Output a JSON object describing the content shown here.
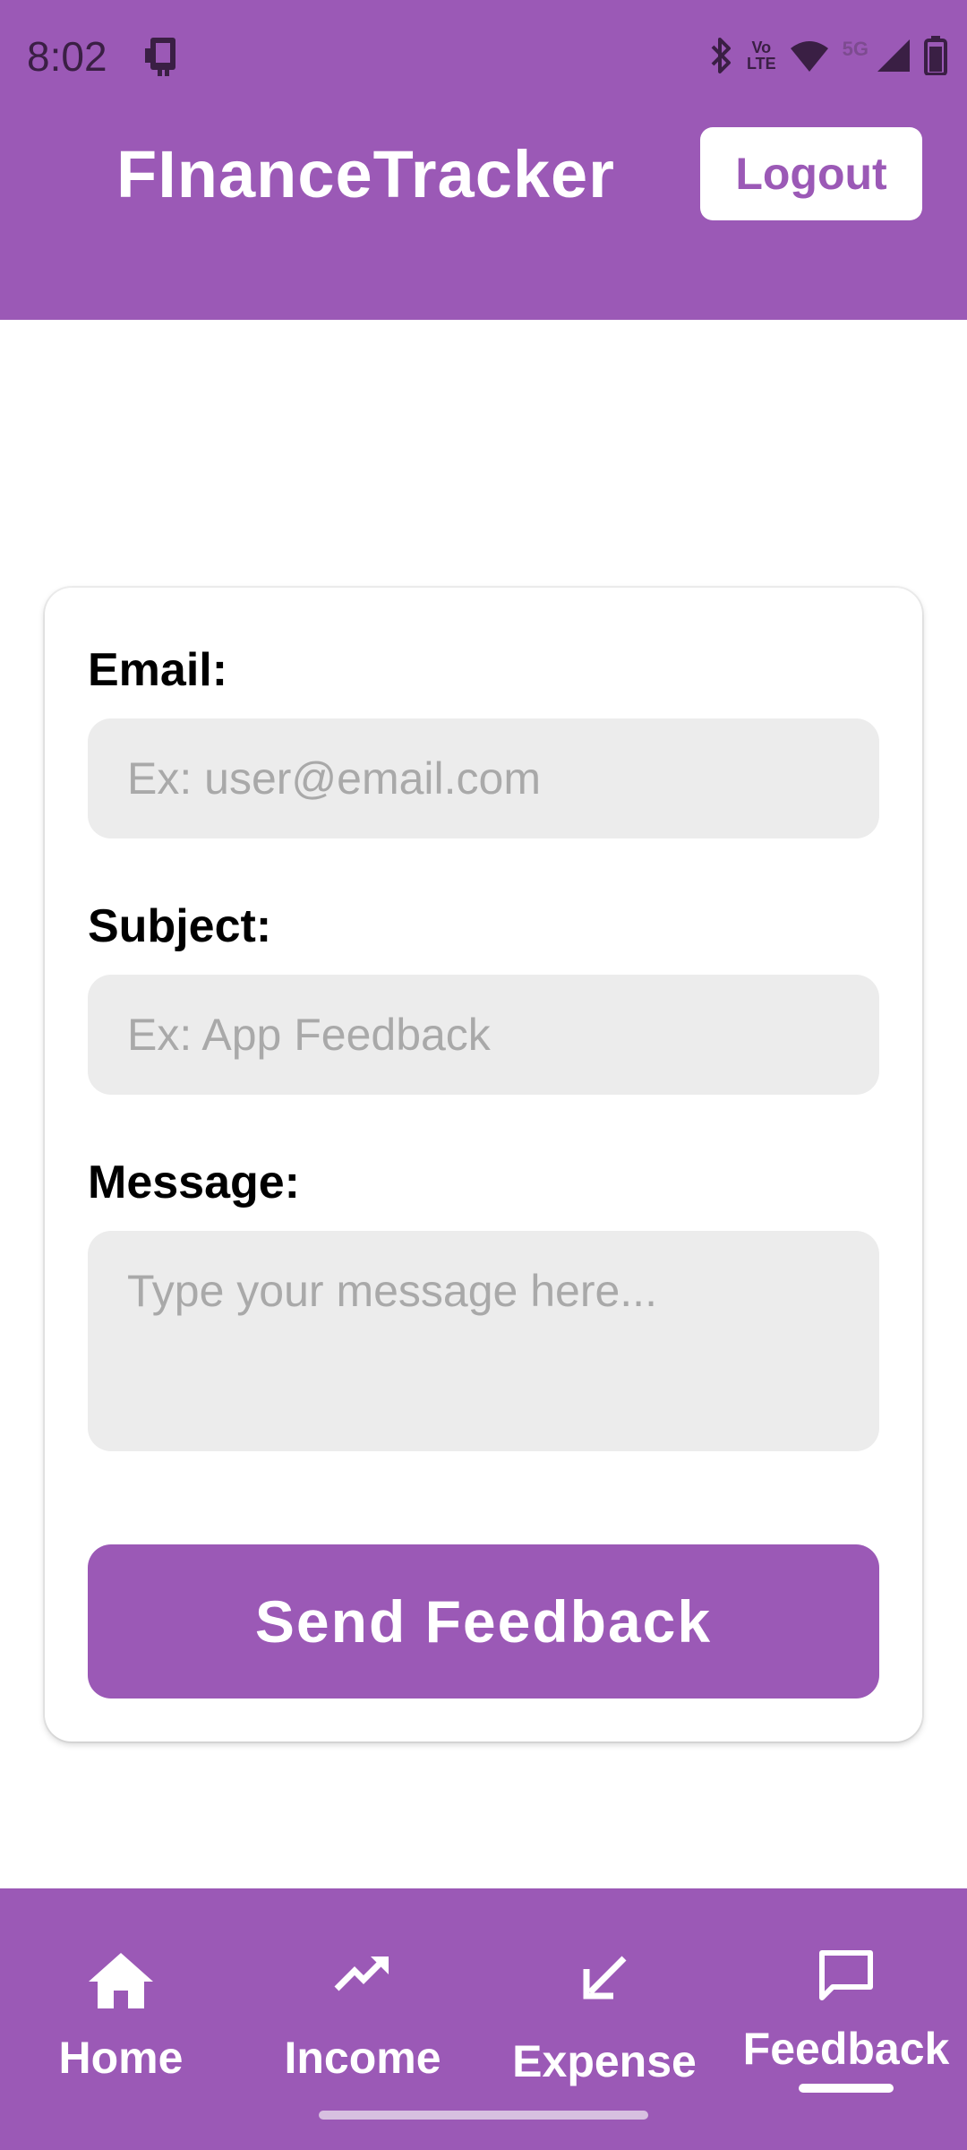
{
  "status_bar": {
    "time": "8:02",
    "vo_lte_top": "Vo",
    "vo_lte_bottom": "LTE",
    "network": "5G"
  },
  "header": {
    "title": "FInanceTracker",
    "logout_label": "Logout"
  },
  "form": {
    "email_label": "Email:",
    "email_placeholder": "Ex: user@email.com",
    "subject_label": "Subject:",
    "subject_placeholder": "Ex: App Feedback",
    "message_label": "Message:",
    "message_placeholder": "Type your message here...",
    "submit_label": "Send Feedback"
  },
  "bottom_nav": {
    "items": [
      {
        "label": "Home",
        "icon": "home-icon"
      },
      {
        "label": "Income",
        "icon": "trending-up-icon"
      },
      {
        "label": "Expense",
        "icon": "arrow-down-left-icon"
      },
      {
        "label": "Feedback",
        "icon": "chat-bubble-icon"
      }
    ],
    "active": "Feedback"
  },
  "colors": {
    "primary": "#9b59b6",
    "input_bg": "#ececec",
    "placeholder": "#a9a9a9",
    "white": "#ffffff"
  }
}
